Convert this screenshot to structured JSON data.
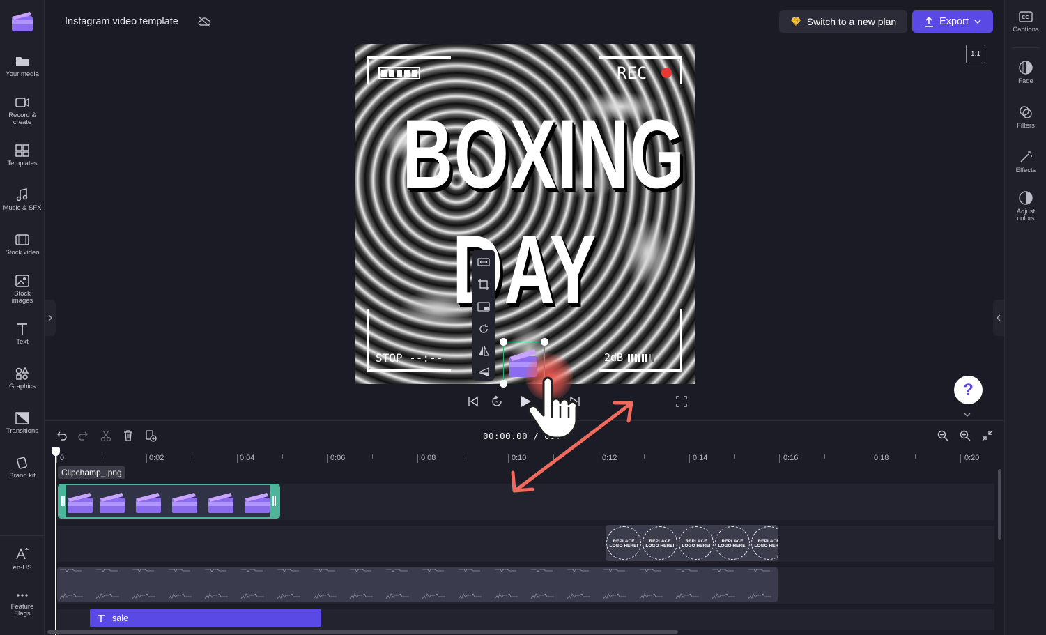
{
  "app": {
    "title": "Instagram video template"
  },
  "sidebar_left": {
    "items": [
      {
        "label": "Your media"
      },
      {
        "label": "Record &\ncreate"
      },
      {
        "label": "Templates"
      },
      {
        "label": "Music & SFX"
      },
      {
        "label": "Stock video"
      },
      {
        "label": "Stock\nimages"
      },
      {
        "label": "Text"
      },
      {
        "label": "Graphics"
      },
      {
        "label": "Transitions"
      },
      {
        "label": "Brand kit"
      }
    ],
    "bottom": [
      {
        "label": "en-US"
      },
      {
        "label": "Feature\nFlags"
      }
    ]
  },
  "sidebar_right": {
    "items": [
      {
        "label": "Captions"
      },
      {
        "label": "Fade"
      },
      {
        "label": "Filters"
      },
      {
        "label": "Effects"
      },
      {
        "label": "Adjust\ncolors"
      }
    ]
  },
  "header": {
    "plan_button": "Switch to a new plan",
    "export_button": "Export",
    "aspect_ratio": "1:1"
  },
  "preview": {
    "headline_1": "BOXING",
    "headline_2": "DAY",
    "rec_label": "REC",
    "stop_label": "STOP --:--",
    "db_label": "2dB"
  },
  "timeline": {
    "timecode": "00:00.00 / 00:",
    "ruler_labels": [
      "0",
      "0:02",
      "0:04",
      "0:06",
      "0:08",
      "0:10",
      "0:12",
      "0:14",
      "0:16",
      "0:18",
      "0:20"
    ],
    "clip_label": "Clipchamp_.png",
    "logo_placeholder": "REPLACE LOGO HERE!",
    "text_clip_label": "sale"
  },
  "colors": {
    "accent": "#5b49e6",
    "selection": "#2bb673",
    "rec_dot": "#e53935",
    "annotation": "#f06a5e"
  }
}
